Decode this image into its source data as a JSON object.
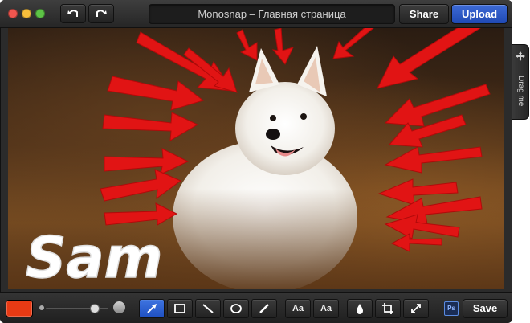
{
  "window": {
    "title": "Monosnap – Главная страница"
  },
  "header": {
    "share_label": "Share",
    "upload_label": "Upload"
  },
  "sidebar_handle": {
    "label": "Drag me"
  },
  "canvas": {
    "annotation_text": "Sam",
    "annotation_color": "#e11414"
  },
  "toolbar": {
    "current_color": "#e83a14",
    "text_tool_label": "Aa",
    "text_tool_label_2": "Aa",
    "ps_label": "Ps",
    "save_label": "Save",
    "tools": [
      "arrow-icon",
      "rectangle-icon",
      "line-icon",
      "ellipse-icon",
      "pen-icon",
      "text-icon",
      "text-outline-icon",
      "blur-icon",
      "crop-icon",
      "resize-icon"
    ]
  }
}
